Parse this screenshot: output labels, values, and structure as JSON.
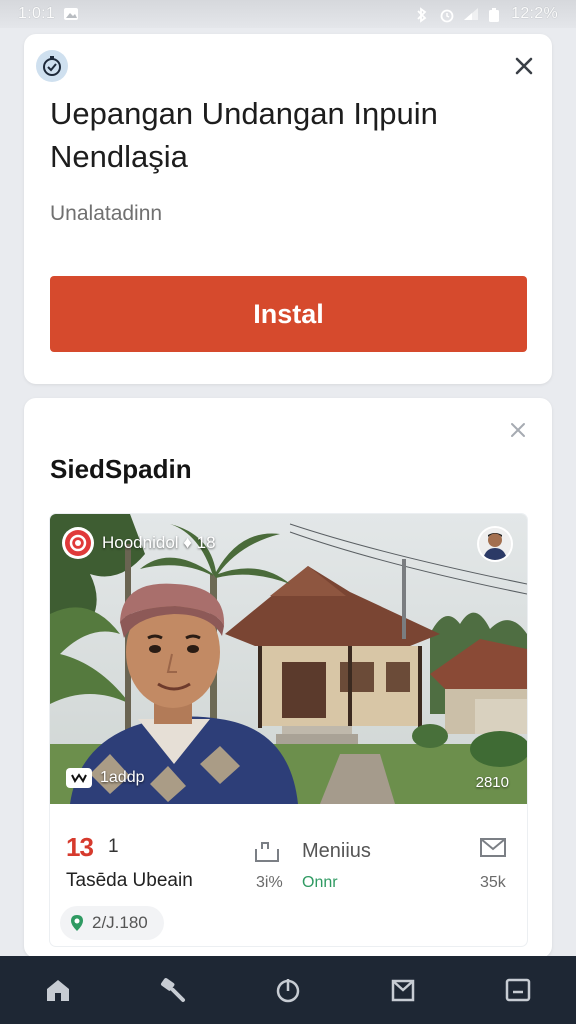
{
  "status_bar": {
    "time": "1:0:1",
    "battery_text": "12:2%"
  },
  "install_card": {
    "logo_icon": "clock-check-icon",
    "title": "Uepangan Undangan Iηpuin Nendlaşia",
    "subtitle": "Unalatadinn",
    "install_label": "Instal",
    "accent_color": "#d64a2d"
  },
  "suggested_card": {
    "section_title": "SiedSpadin",
    "media": {
      "channel_name": "Hoodnidol ♦ 18",
      "overlay_tag": "1addp",
      "overlay_time": "2810",
      "count_big": "13",
      "count_small": "1",
      "title": "Tasēda Ubeain",
      "menu_label": "Meniius",
      "stat_a": "3i%",
      "stat_b": "Onnr",
      "stat_c": "35k",
      "location": "2/J.180",
      "positive_color": "#2f9a62"
    }
  },
  "bottom_nav": {
    "items": [
      "home-icon",
      "search-icon",
      "timer-icon",
      "bookmark-icon",
      "window-icon"
    ]
  }
}
